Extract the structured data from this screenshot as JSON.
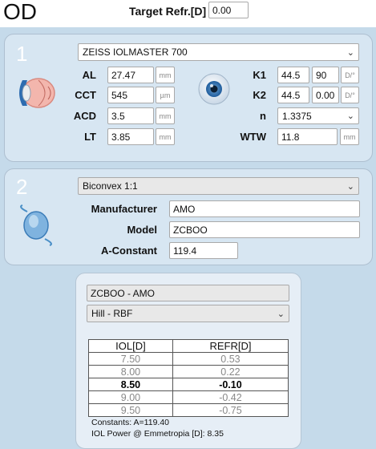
{
  "header": {
    "eye": "OD",
    "target_label": "Target Refr.[D]",
    "target_value": "0.00"
  },
  "biometry": {
    "number": "1",
    "device": "ZEISS IOLMASTER 700",
    "left": [
      {
        "label": "AL",
        "value": "27.47",
        "unit": "mm"
      },
      {
        "label": "CCT",
        "value": "545",
        "unit": "µm"
      },
      {
        "label": "ACD",
        "value": "3.5",
        "unit": "mm"
      },
      {
        "label": "LT",
        "value": "3.85",
        "unit": "mm"
      }
    ],
    "k1": {
      "label": "K1",
      "value": "44.5",
      "axis": "90",
      "unit": "D/°"
    },
    "k2": {
      "label": "K2",
      "value": "44.5",
      "axis": "0.00",
      "unit": "D/°"
    },
    "n": {
      "label": "n",
      "value": "1.3375"
    },
    "wtw": {
      "label": "WTW",
      "value": "11.8",
      "unit": "mm"
    }
  },
  "lens": {
    "number": "2",
    "type": "Biconvex 1:1",
    "manufacturer_label": "Manufacturer",
    "manufacturer": "AMO",
    "model_label": "Model",
    "model": "ZCBOO",
    "aconst_label": "A-Constant",
    "aconst": "119.4"
  },
  "results": {
    "lens_name": "ZCBOO - AMO",
    "formula": "Hill - RBF",
    "headers": [
      "IOL[D]",
      "REFR[D]"
    ],
    "rows": [
      {
        "iol": "7.50",
        "refr": "0.53"
      },
      {
        "iol": "8.00",
        "refr": "0.22"
      },
      {
        "iol": "8.50",
        "refr": "-0.10"
      },
      {
        "iol": "9.00",
        "refr": "-0.42"
      },
      {
        "iol": "9.50",
        "refr": "-0.75"
      }
    ],
    "constants": "Constants: A=119.40",
    "emmetropia": "IOL Power @ Emmetropia [D]: 8.35"
  }
}
